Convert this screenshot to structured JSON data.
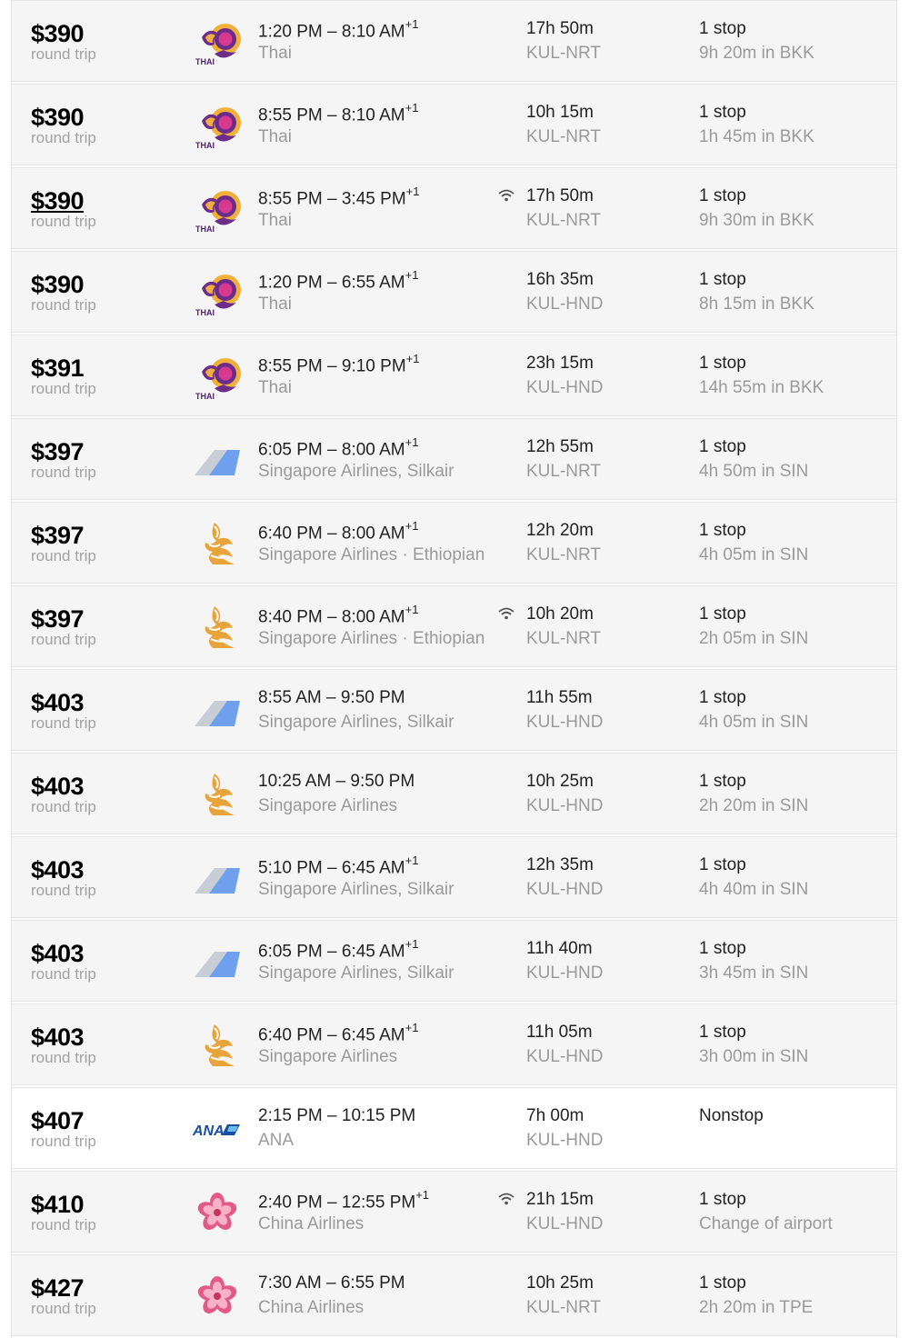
{
  "labels": {
    "round_trip": "round trip"
  },
  "flights": [
    {
      "price": "$390",
      "logo": "thai-logo-icon",
      "departure": "1:20 PM",
      "arrival": "8:10 AM",
      "day_offset": "+1",
      "airline": "Thai",
      "wifi": false,
      "duration": "17h 50m",
      "route": "KUL-NRT",
      "stops": "1 stop",
      "layover": "9h 20m in BKK",
      "highlight": false,
      "underline_price": false
    },
    {
      "price": "$390",
      "logo": "thai-logo-icon",
      "departure": "8:55 PM",
      "arrival": "8:10 AM",
      "day_offset": "+1",
      "airline": "Thai",
      "wifi": false,
      "duration": "10h 15m",
      "route": "KUL-NRT",
      "stops": "1 stop",
      "layover": "1h 45m in BKK",
      "highlight": false,
      "underline_price": false
    },
    {
      "price": "$390",
      "logo": "thai-logo-icon",
      "departure": "8:55 PM",
      "arrival": "3:45 PM",
      "day_offset": "+1",
      "airline": "Thai",
      "wifi": true,
      "duration": "17h 50m",
      "route": "KUL-NRT",
      "stops": "1 stop",
      "layover": "9h 30m in BKK",
      "highlight": false,
      "underline_price": true
    },
    {
      "price": "$390",
      "logo": "thai-logo-icon",
      "departure": "1:20 PM",
      "arrival": "6:55 AM",
      "day_offset": "+1",
      "airline": "Thai",
      "wifi": false,
      "duration": "16h 35m",
      "route": "KUL-HND",
      "stops": "1 stop",
      "layover": "8h 15m in BKK",
      "highlight": false,
      "underline_price": false
    },
    {
      "price": "$391",
      "logo": "thai-logo-icon",
      "departure": "8:55 PM",
      "arrival": "9:10 PM",
      "day_offset": "+1",
      "airline": "Thai",
      "wifi": false,
      "duration": "23h 15m",
      "route": "KUL-HND",
      "stops": "1 stop",
      "layover": "14h 55m in BKK",
      "highlight": false,
      "underline_price": false
    },
    {
      "price": "$397",
      "logo": "multi-airline-tail-icon",
      "departure": "6:05 PM",
      "arrival": "8:00 AM",
      "day_offset": "+1",
      "airline": "Singapore Airlines, Silkair",
      "wifi": false,
      "duration": "12h 55m",
      "route": "KUL-NRT",
      "stops": "1 stop",
      "layover": "4h 50m in SIN",
      "highlight": false,
      "underline_price": false
    },
    {
      "price": "$397",
      "logo": "singapore-airlines-logo-icon",
      "departure": "6:40 PM",
      "arrival": "8:00 AM",
      "day_offset": "+1",
      "airline": "Singapore Airlines · Ethiopian",
      "wifi": false,
      "duration": "12h 20m",
      "route": "KUL-NRT",
      "stops": "1 stop",
      "layover": "4h 05m in SIN",
      "highlight": false,
      "underline_price": false
    },
    {
      "price": "$397",
      "logo": "singapore-airlines-logo-icon",
      "departure": "8:40 PM",
      "arrival": "8:00 AM",
      "day_offset": "+1",
      "airline": "Singapore Airlines · Ethiopian",
      "wifi": true,
      "duration": "10h 20m",
      "route": "KUL-NRT",
      "stops": "1 stop",
      "layover": "2h 05m in SIN",
      "highlight": false,
      "underline_price": false
    },
    {
      "price": "$403",
      "logo": "multi-airline-tail-icon",
      "departure": "8:55 AM",
      "arrival": "9:50 PM",
      "day_offset": "",
      "airline": "Singapore Airlines, Silkair",
      "wifi": false,
      "duration": "11h 55m",
      "route": "KUL-HND",
      "stops": "1 stop",
      "layover": "4h 05m in SIN",
      "highlight": false,
      "underline_price": false
    },
    {
      "price": "$403",
      "logo": "singapore-airlines-logo-icon",
      "departure": "10:25 AM",
      "arrival": "9:50 PM",
      "day_offset": "",
      "airline": "Singapore Airlines",
      "wifi": false,
      "duration": "10h 25m",
      "route": "KUL-HND",
      "stops": "1 stop",
      "layover": "2h 20m in SIN",
      "highlight": false,
      "underline_price": false
    },
    {
      "price": "$403",
      "logo": "multi-airline-tail-icon",
      "departure": "5:10 PM",
      "arrival": "6:45 AM",
      "day_offset": "+1",
      "airline": "Singapore Airlines, Silkair",
      "wifi": false,
      "duration": "12h 35m",
      "route": "KUL-HND",
      "stops": "1 stop",
      "layover": "4h 40m in SIN",
      "highlight": false,
      "underline_price": false
    },
    {
      "price": "$403",
      "logo": "multi-airline-tail-icon",
      "departure": "6:05 PM",
      "arrival": "6:45 AM",
      "day_offset": "+1",
      "airline": "Singapore Airlines, Silkair",
      "wifi": false,
      "duration": "11h 40m",
      "route": "KUL-HND",
      "stops": "1 stop",
      "layover": "3h 45m in SIN",
      "highlight": false,
      "underline_price": false
    },
    {
      "price": "$403",
      "logo": "singapore-airlines-logo-icon",
      "departure": "6:40 PM",
      "arrival": "6:45 AM",
      "day_offset": "+1",
      "airline": "Singapore Airlines",
      "wifi": false,
      "duration": "11h 05m",
      "route": "KUL-HND",
      "stops": "1 stop",
      "layover": "3h 00m in SIN",
      "highlight": false,
      "underline_price": false
    },
    {
      "price": "$407",
      "logo": "ana-logo-icon",
      "departure": "2:15 PM",
      "arrival": "10:15 PM",
      "day_offset": "",
      "airline": "ANA",
      "wifi": false,
      "duration": "7h 00m",
      "route": "KUL-HND",
      "stops": "Nonstop",
      "layover": "",
      "highlight": true,
      "underline_price": false
    },
    {
      "price": "$410",
      "logo": "china-airlines-logo-icon",
      "departure": "2:40 PM",
      "arrival": "12:55 PM",
      "day_offset": "+1",
      "airline": "China Airlines",
      "wifi": true,
      "duration": "21h 15m",
      "route": "KUL-HND",
      "stops": "1 stop",
      "layover": "Change of airport",
      "highlight": false,
      "underline_price": false
    },
    {
      "price": "$427",
      "logo": "china-airlines-logo-icon",
      "departure": "7:30 AM",
      "arrival": "6:55 PM",
      "day_offset": "",
      "airline": "China Airlines",
      "wifi": false,
      "duration": "10h 25m",
      "route": "KUL-NRT",
      "stops": "1 stop",
      "layover": "2h 20m in TPE",
      "highlight": false,
      "underline_price": false
    }
  ]
}
